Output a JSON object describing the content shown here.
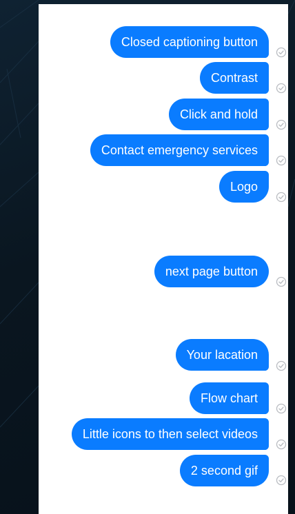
{
  "thread": {
    "messages": [
      {
        "text": "Closed captioning button",
        "status_icon": "sent-check-icon"
      },
      {
        "text": "Contrast",
        "status_icon": "sent-check-icon"
      },
      {
        "text": "Click and hold",
        "status_icon": "sent-check-icon"
      },
      {
        "text": "Contact emergency services",
        "status_icon": "sent-check-icon"
      },
      {
        "text": "Logo",
        "status_icon": "sent-check-icon"
      },
      {
        "text": "next page button",
        "status_icon": "sent-check-icon"
      },
      {
        "text": "Your lacation",
        "status_icon": "sent-check-icon"
      },
      {
        "text": "Flow chart",
        "status_icon": "sent-check-icon"
      },
      {
        "text": "Little icons to then select videos",
        "status_icon": "sent-check-icon"
      },
      {
        "text": "2 second gif",
        "status_icon": "sent-check-icon"
      }
    ]
  },
  "colors": {
    "bubble": "#0a7cff",
    "bubble_text": "#ffffff",
    "panel_background": "#ffffff",
    "page_background": "#0b1722",
    "check_icon": "#b9bcc1"
  }
}
